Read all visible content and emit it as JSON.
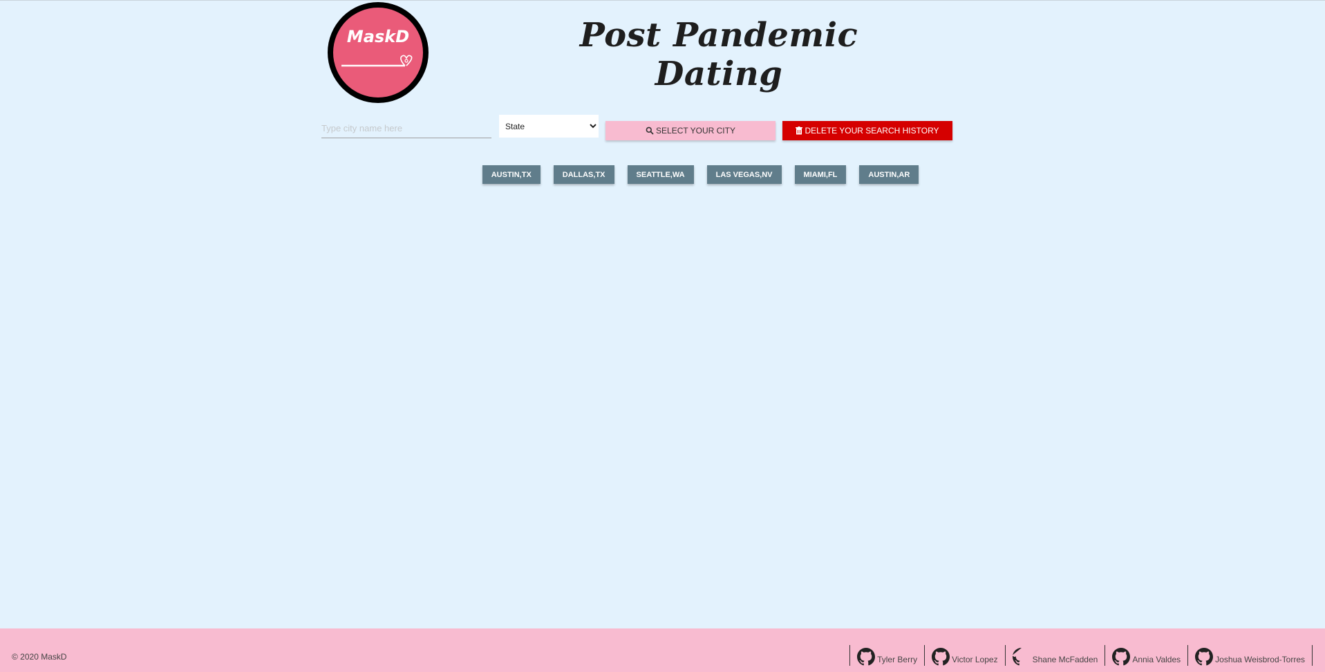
{
  "logo": {
    "text": "MaskD",
    "color": "#ea5b79"
  },
  "header": {
    "title": "Post Pandemic Dating"
  },
  "search": {
    "city_placeholder": "Type city name here",
    "state_selected": "State",
    "select_label": "SELECT YOUR CITY",
    "select_icon": "search-icon",
    "delete_label": "DELETE YOUR SEARCH HISTORY",
    "delete_icon": "trash-icon"
  },
  "history": [
    "AUSTIN,TX",
    "DALLAS,TX",
    "SEATTLE,WA",
    "LAS VEGAS,NV",
    "MIAMI,FL",
    "AUSTIN,AR"
  ],
  "footer": {
    "copyright": "© 2020 MaskD",
    "members": [
      "Tyler Berry",
      "Victor Lopez",
      "Shane McFadden",
      "Annia Valdes",
      "Joshua Weisbrod-Torres"
    ],
    "member_icon": "github-icon"
  },
  "colors": {
    "background": "#e3f2fd",
    "footer": "#f8bbd0",
    "delete": "#d50000",
    "history_button": "#607d8b",
    "select_button": "#f8bbd0"
  }
}
